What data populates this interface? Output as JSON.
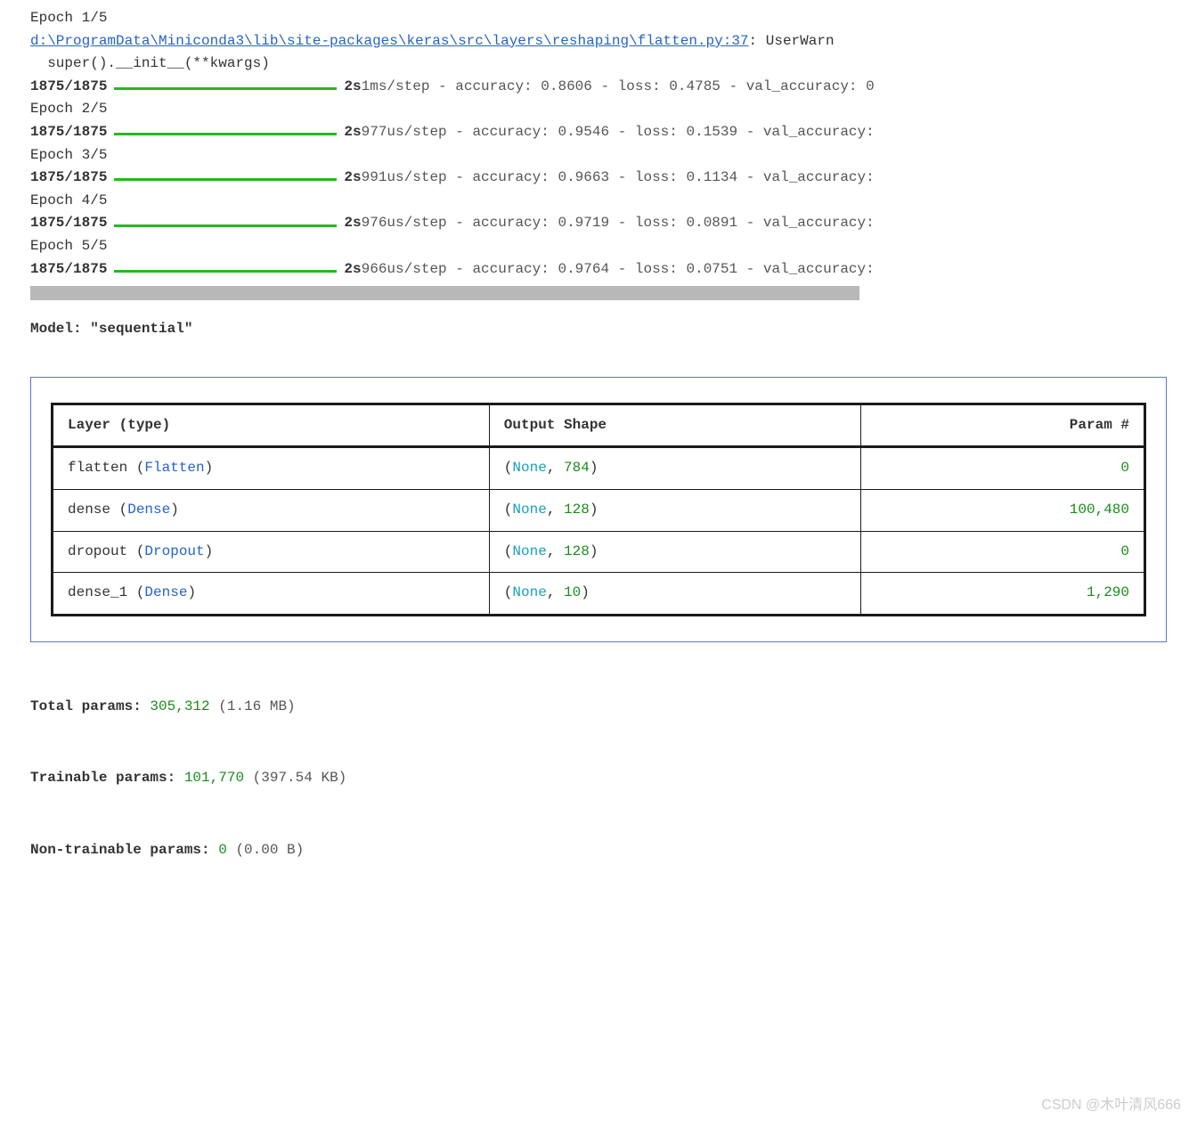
{
  "training": {
    "epoch1_label": "Epoch 1/5",
    "warning_path": "d:\\ProgramData\\Miniconda3\\lib\\site-packages\\keras\\src\\layers\\reshaping\\flatten.py:37",
    "warning_suffix": ": UserWarn",
    "super_line": "  super().__init__(**kwargs)",
    "steps": "1875/1875",
    "time": "2s",
    "epoch1_metrics": " 1ms/step - accuracy: 0.8606 - loss: 0.4785 - val_accuracy: 0",
    "epoch2_label": "Epoch 2/5",
    "epoch2_metrics": " 977us/step - accuracy: 0.9546 - loss: 0.1539 - val_accuracy:",
    "epoch3_label": "Epoch 3/5",
    "epoch3_metrics": " 991us/step - accuracy: 0.9663 - loss: 0.1134 - val_accuracy:",
    "epoch4_label": "Epoch 4/5",
    "epoch4_metrics": " 976us/step - accuracy: 0.9719 - loss: 0.0891 - val_accuracy:",
    "epoch5_label": "Epoch 5/5",
    "epoch5_metrics": " 966us/step - accuracy: 0.9764 - loss: 0.0751 - val_accuracy:"
  },
  "model": {
    "title": "Model: \"sequential\"",
    "headers": {
      "layer": "Layer (type)",
      "shape": "Output Shape",
      "params": "Param #"
    },
    "rows": [
      {
        "name": "flatten",
        "type": "Flatten",
        "none": "None",
        "dim": "784",
        "params": "0"
      },
      {
        "name": "dense",
        "type": "Dense",
        "none": "None",
        "dim": "128",
        "params": "100,480"
      },
      {
        "name": "dropout",
        "type": "Dropout",
        "none": "None",
        "dim": "128",
        "params": "0"
      },
      {
        "name": "dense_1",
        "type": "Dense",
        "none": "None",
        "dim": "10",
        "params": "1,290"
      }
    ]
  },
  "summary": {
    "total_label": " Total params: ",
    "total_value": "305,312",
    "total_size": " (1.16 MB)",
    "trainable_label": " Trainable params: ",
    "trainable_value": "101,770",
    "trainable_size": " (397.54 KB)",
    "nontrainable_label": " Non-trainable params: ",
    "nontrainable_value": "0",
    "nontrainable_size": " (0.00 B)"
  },
  "watermark": "CSDN @木叶清风666"
}
